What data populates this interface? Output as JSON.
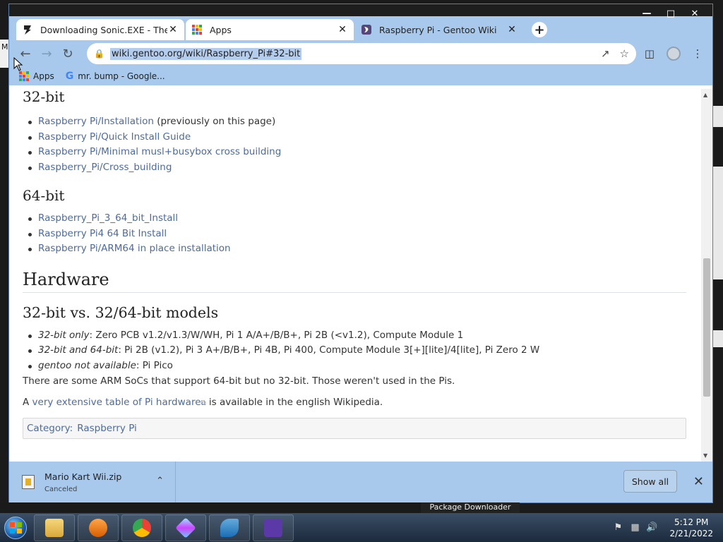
{
  "desktop": {
    "edge_text": "M"
  },
  "tabs": [
    {
      "title": "Downloading Sonic.EXE - The Ga",
      "favicon": "gamejolt-icon",
      "active": false
    },
    {
      "title": "Apps",
      "favicon": "apps-grid-icon",
      "active": false
    },
    {
      "title": "Raspberry Pi - Gentoo Wiki",
      "favicon": "gentoo-icon",
      "active": true
    }
  ],
  "omnibox": {
    "url": "wiki.gentoo.org/wiki/Raspberry_Pi#32-bit"
  },
  "bookmarks": [
    {
      "label": "Apps",
      "icon": "apps-grid-icon"
    },
    {
      "label": "mr. bump - Google...",
      "icon": "google-icon"
    }
  ],
  "page": {
    "sec32": {
      "heading": "32-bit",
      "items": [
        {
          "link": "Raspberry Pi/Installation",
          "suffix": " (previously on this page)"
        },
        {
          "link": "Raspberry Pi/Quick Install Guide",
          "suffix": ""
        },
        {
          "link": "Raspberry Pi/Minimal musl+busybox cross building",
          "suffix": ""
        },
        {
          "link": "Raspberry_Pi/Cross_building",
          "suffix": ""
        }
      ]
    },
    "sec64": {
      "heading": "64-bit",
      "items": [
        {
          "link": "Raspberry_Pi_3_64_bit_Install"
        },
        {
          "link": "Raspberry Pi4 64 Bit Install"
        },
        {
          "link": "Raspberry Pi/ARM64 in place installation"
        }
      ]
    },
    "hardware_heading": "Hardware",
    "models_heading": "32-bit vs. 32/64-bit models",
    "models": [
      {
        "em": "32-bit only",
        "text": ": Zero PCB v1.2/v1.3/W/WH, Pi 1 A/A+/B/B+, Pi 2B (<v1.2), Compute Module 1"
      },
      {
        "em": "32-bit and 64-bit",
        "text": ": Pi 2B (v1.2), Pi 3 A+/B/B+, Pi 4B, Pi 400, Compute Module 3[+][lite]/4[lite], Pi Zero 2 W"
      },
      {
        "em": "gentoo not available",
        "text": ": Pi Pico"
      }
    ],
    "soc_note": "There are some ARM SoCs that support 64-bit but no 32-bit. Those weren't used in the Pis.",
    "wiki_prefix": "A ",
    "wiki_link": "very extensive table of Pi hardware",
    "wiki_suffix": " is available in the english Wikipedia.",
    "category_label": "Category:",
    "category_value": "Raspberry Pi"
  },
  "downloads": {
    "file_name": "Mario Kart Wii.zip",
    "status": "Canceled",
    "show_all_label": "Show all"
  },
  "taskbar": {
    "peek_label": "Package Downloader",
    "time": "5:12 PM",
    "date": "2/21/2022"
  },
  "colors": {
    "chrome_frame": "#a8c9ec",
    "link": "#4e6b9c",
    "text": "#333333"
  }
}
